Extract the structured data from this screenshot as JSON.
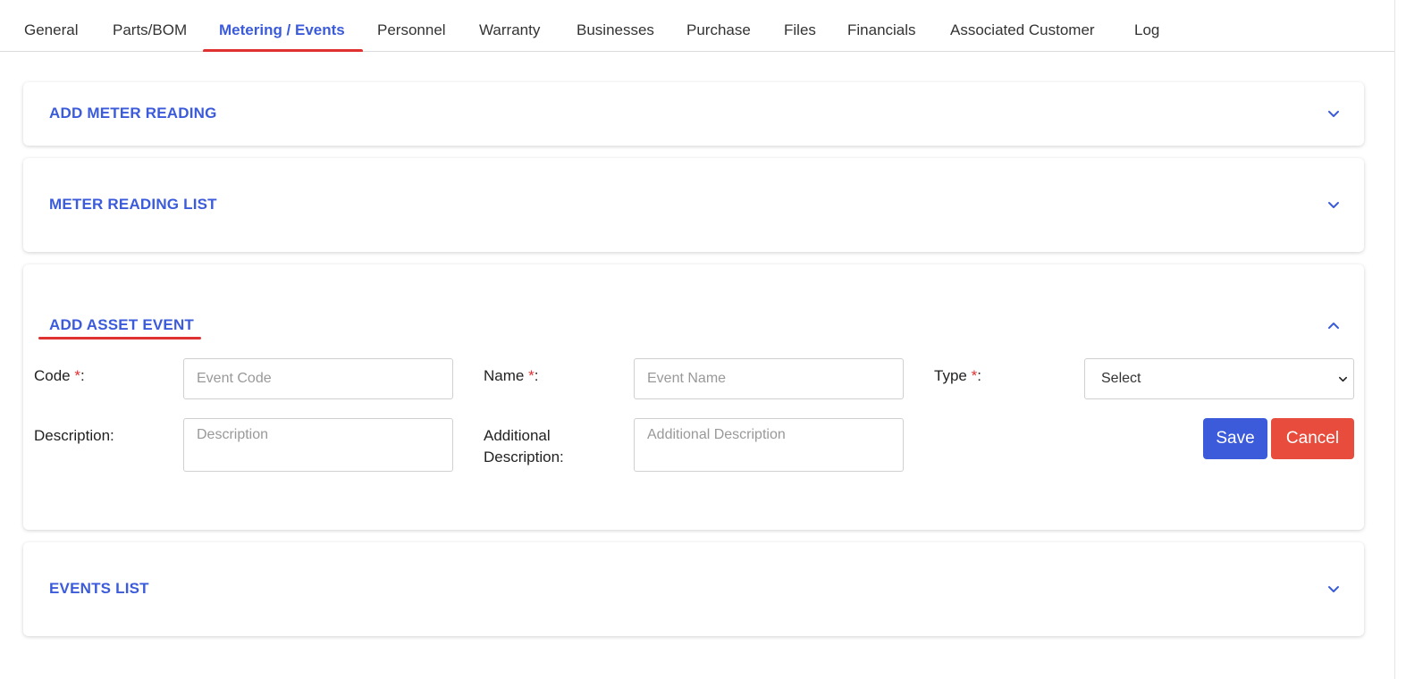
{
  "tabs": [
    {
      "label": "General"
    },
    {
      "label": "Parts/BOM"
    },
    {
      "label": "Metering / Events"
    },
    {
      "label": "Personnel"
    },
    {
      "label": "Warranty"
    },
    {
      "label": "Businesses"
    },
    {
      "label": "Purchase"
    },
    {
      "label": "Files"
    },
    {
      "label": "Financials"
    },
    {
      "label": "Associated Customer"
    },
    {
      "label": "Log"
    }
  ],
  "active_tab": "Metering / Events",
  "panels": {
    "add_meter_reading": {
      "title": "ADD METER READING",
      "icon": "chevron-down-icon"
    },
    "meter_reading_list": {
      "title": "METER READING LIST",
      "icon": "chevron-down-icon"
    },
    "add_asset_event": {
      "title": "ADD ASSET EVENT",
      "icon": "chevron-up-icon"
    },
    "events_list": {
      "title": "EVENTS LIST",
      "icon": "chevron-down-icon"
    }
  },
  "form": {
    "code": {
      "label": "Code ",
      "required": "*",
      "suffix": ":",
      "placeholder": "Event Code",
      "value": ""
    },
    "name": {
      "label": "Name ",
      "required": "*",
      "suffix": ":",
      "placeholder": "Event Name",
      "value": ""
    },
    "type": {
      "label": "Type ",
      "required": "*",
      "suffix": ":",
      "selected": "Select"
    },
    "description": {
      "label": "Description:",
      "placeholder": "Description",
      "value": ""
    },
    "additional_description": {
      "label_line1": "Additional",
      "label_line2": "Description:",
      "placeholder": "Additional Description",
      "value": ""
    },
    "save_label": "Save",
    "cancel_label": "Cancel"
  },
  "colors": {
    "accent": "#3b5bdb",
    "danger": "#e74c3c",
    "required": "#e03131"
  }
}
